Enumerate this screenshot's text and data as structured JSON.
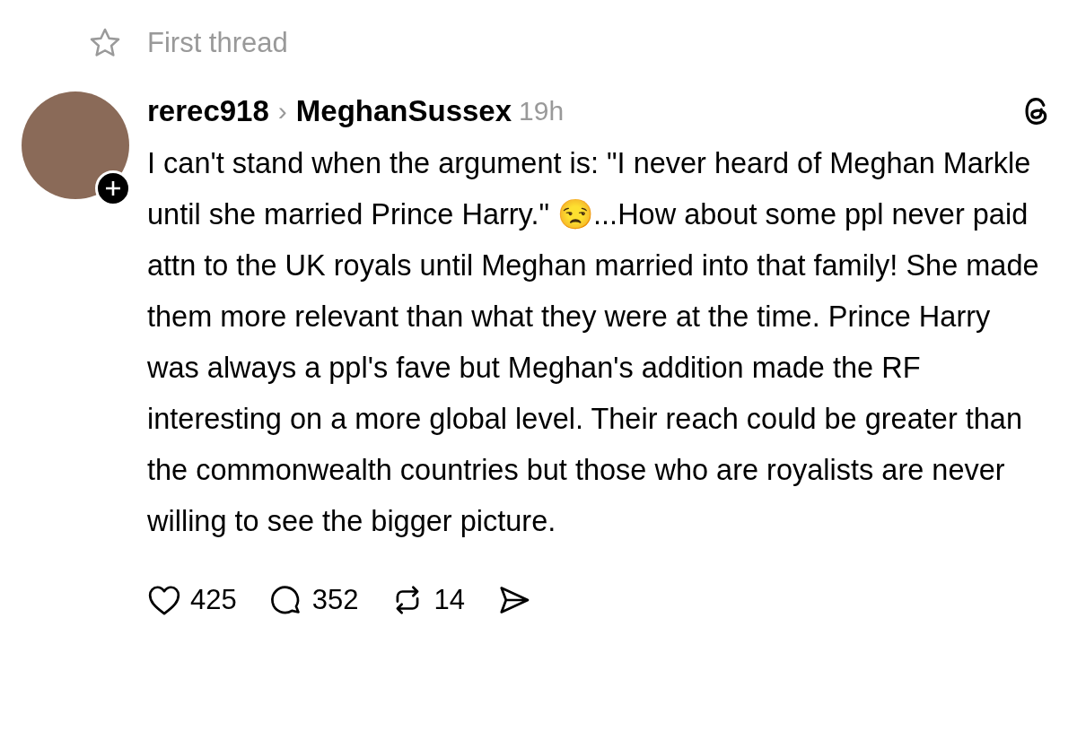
{
  "header": {
    "label": "First thread"
  },
  "post": {
    "author": "rerec918",
    "separator": "›",
    "reply_to": "MeghanSussex",
    "time": "19h",
    "text": "I can't stand when the argument is: \"I never heard of Meghan Markle until she married Prince Harry.\" 😒...How about some ppl never paid attn to the UK royals until Meghan married into that family! She made them more relevant than what they were at the time. Prince Harry was always a ppl's fave but Meghan's addition made the RF interesting on a more global level. Their reach could be greater than the commonwealth countries but those who are royalists are never willing to see the bigger picture.",
    "actions": [
      {
        "kind": "like",
        "count": "425"
      },
      {
        "kind": "comment",
        "count": "352"
      },
      {
        "kind": "repost",
        "count": "14"
      },
      {
        "kind": "share"
      }
    ]
  }
}
